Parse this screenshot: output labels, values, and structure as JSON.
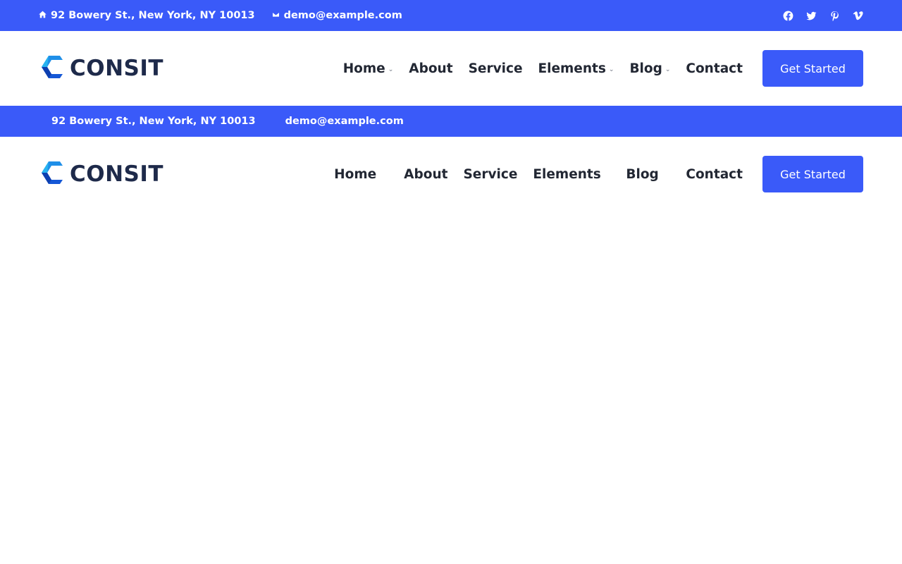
{
  "colors": {
    "brand": "#3a5af9",
    "logo_text": "#1e2a4a",
    "nav_text": "#222733"
  },
  "top_bar": {
    "address": "92 Bowery St., New York, NY 10013",
    "email": "demo@example.com",
    "address_icon": "home-icon",
    "email_icon": "envelope-icon",
    "social": [
      "facebook-icon",
      "twitter-icon",
      "pinterest-icon",
      "vimeo-icon"
    ]
  },
  "header": {
    "logo_text": "CONSIT",
    "logo_icon": "consit-c-logo-icon",
    "menu": [
      {
        "label": "Home",
        "dropdown": true
      },
      {
        "label": "About",
        "dropdown": false
      },
      {
        "label": "Service",
        "dropdown": false
      },
      {
        "label": "Elements",
        "dropdown": true
      },
      {
        "label": "Blog",
        "dropdown": true
      },
      {
        "label": "Contact",
        "dropdown": false
      }
    ],
    "cta_label": "Get Started"
  },
  "sticky_top_bar": {
    "address": "92 Bowery St., New York, NY 10013",
    "email": "demo@example.com"
  },
  "sticky_header": {
    "logo_text": "CONSIT",
    "menu": [
      "Home",
      "About",
      "Service",
      "Elements",
      "Blog",
      "Contact"
    ],
    "cta_label": "Get Started"
  }
}
